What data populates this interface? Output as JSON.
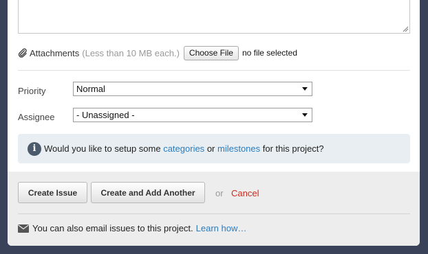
{
  "attachments": {
    "label": "Attachments",
    "hint": "(Less than 10 MB each.)",
    "choose_button": "Choose File",
    "file_status": "no file selected"
  },
  "fields": {
    "priority": {
      "label": "Priority",
      "value": "Normal"
    },
    "assignee": {
      "label": "Assignee",
      "value": "- Unassigned -"
    }
  },
  "info": {
    "prefix": "Would you like to setup some",
    "categories_link": "categories",
    "or": "or",
    "milestones_link": "milestones",
    "suffix": "for this project?"
  },
  "actions": {
    "create_issue": "Create Issue",
    "create_and_add_another": "Create and Add Another",
    "or": "or",
    "cancel": "Cancel"
  },
  "email": {
    "text": "You can also email issues to this project.",
    "learn_link": "Learn how…"
  },
  "colors": {
    "link": "#2a7cbf",
    "cancel": "#cc2a1a",
    "background": "#394259"
  }
}
